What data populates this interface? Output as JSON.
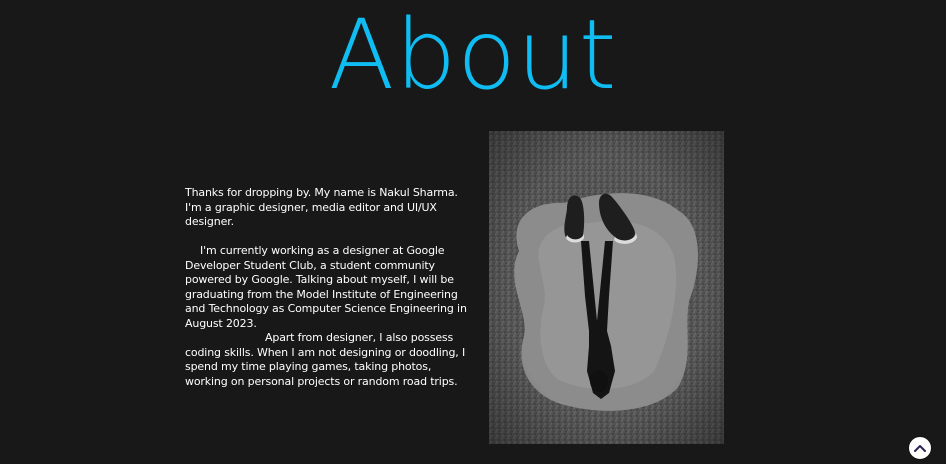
{
  "about": {
    "title": "About",
    "paragraph_1": "Thanks for dropping by. My name is Nakul Sharma. I'm a graphic designer, media editor and UI/UX designer.",
    "paragraph_2": "I'm currently working as a designer at Google Developer Student Club, a student community powered by Google. Talking about myself, I will be graduating from the Model Institute of Engineering and Technology as Computer Science Engineering in August 2023.",
    "paragraph_3": "Apart from designer, I also possess coding skills. When I am not designing or doodling, I spend my time playing games, taking photos, working on personal projects or random road trips."
  },
  "colors": {
    "background": "#181818",
    "title": "#10bdf2",
    "text": "#ffffff"
  },
  "icons": {
    "scroll_top": "chevron-up-icon"
  }
}
